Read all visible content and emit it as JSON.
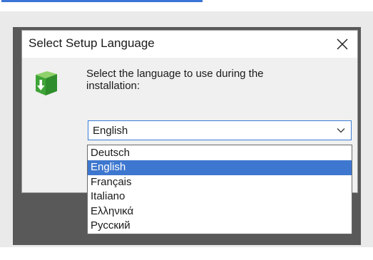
{
  "dialog": {
    "title": "Select Setup Language",
    "prompt": "Select the language to use during the installation:",
    "close_icon": "close-icon",
    "setup_icon": "setup-install-icon"
  },
  "combo": {
    "value": "English",
    "arrow_icon": "chevron-down-icon"
  },
  "dropdown": {
    "selected_index": 1,
    "options": [
      "Deutsch",
      "English",
      "Français",
      "Italiano",
      "Ελληνικά",
      "Русский"
    ]
  },
  "colors": {
    "accent": "#3b74d7",
    "selection": "#3e77cf",
    "dialog_body": "#f0f0f0",
    "background_dark": "#595959"
  }
}
